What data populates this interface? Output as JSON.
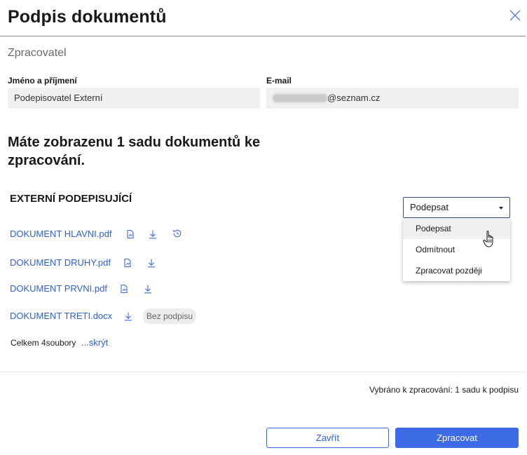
{
  "dialog": {
    "title": "Podpis dokumentů",
    "subtitle": "Zpracovatel"
  },
  "form": {
    "name_label": "Jméno a příjmení",
    "name_value": "Podepisovatel Externí",
    "email_label": "E-mail",
    "email_domain": "@seznam.cz"
  },
  "heading": "Máte zobrazenu 1 sadu dokumentů ke zpracování.",
  "section_title": "EXTERNÍ PODEPISUJÍCÍ",
  "documents": [
    {
      "name": "DOKUMENT HLAVNI.pdf"
    },
    {
      "name": "DOKUMENT DRUHY.pdf"
    },
    {
      "name": "DOKUMENT PRVNI.pdf"
    },
    {
      "name": "DOKUMENT TRETI.docx",
      "badge": "Bez podpisu"
    }
  ],
  "summary": {
    "total": "Celkem 4soubory",
    "hide_link": "...skrýt"
  },
  "action_select": {
    "selected": "Podepsat",
    "options": [
      "Podepsat",
      "Odmítnout",
      "Zpracovat později"
    ]
  },
  "selected_info": "Vybráno k zpracování: 1 sadu k podpisu",
  "buttons": {
    "close": "Zavřít",
    "process": "Zpracovat"
  },
  "colors": {
    "accent": "#3d6be6",
    "link": "#2e5fd9",
    "field_bg": "#f0f0f0"
  },
  "icons": {
    "close": "close-icon",
    "sign": "sign-document-icon",
    "download": "download-icon",
    "history": "history-icon",
    "cursor": "hand-pointer-icon"
  }
}
